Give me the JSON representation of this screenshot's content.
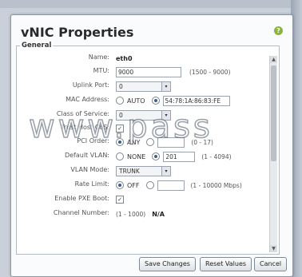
{
  "dialog": {
    "title": "vNIC Properties",
    "help_icon": "?"
  },
  "general": {
    "legend": "General",
    "name": {
      "label": "Name:",
      "value": "eth0"
    },
    "mtu": {
      "label": "MTU:",
      "value": "9000",
      "hint": "(1500 - 9000)"
    },
    "uplink_port": {
      "label": "Uplink Port:",
      "value": "0"
    },
    "mac_address": {
      "label": "MAC Address:",
      "auto_label": "AUTO",
      "value": "54:78:1A:86:83:FE"
    },
    "class_of_service": {
      "label": "Class of Service:",
      "value": "0"
    },
    "trust_host_cos": {
      "label": "Trust Host CoS:"
    },
    "pci_order": {
      "label": "PCI Order:",
      "any_label": "ANY",
      "value": "",
      "hint": "(0 - 17)"
    },
    "default_vlan": {
      "label": "Default VLAN:",
      "none_label": "NONE",
      "value": "201",
      "hint": "(1 - 4094)"
    },
    "vlan_mode": {
      "label": "VLAN Mode:",
      "value": "TRUNK"
    },
    "rate_limit": {
      "label": "Rate Limit:",
      "off_label": "OFF",
      "value": "",
      "hint": "(1 - 10000 Mbps)"
    },
    "pxe_boot": {
      "label": "Enable PXE Boot:"
    },
    "channel_number": {
      "label": "Channel Number:",
      "hint": "(1 - 1000)",
      "value": "N/A"
    }
  },
  "buttons": {
    "save": "Save Changes",
    "reset": "Reset Values",
    "cancel": "Cancel"
  },
  "watermark": "www.pass",
  "colors": {
    "radio_selected": "#3d5d8a",
    "help_icon": "#89b63a"
  }
}
